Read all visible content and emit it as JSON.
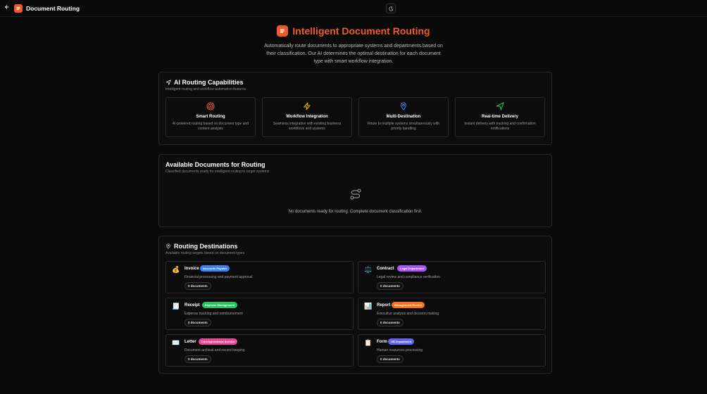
{
  "topbar": {
    "back_icon": "arrow-left-icon",
    "title": "Document Routing",
    "theme_icon": "moon-icon"
  },
  "hero": {
    "title": "Intelligent Document Routing",
    "description": "Automatically route documents to appropriate systems and departments based on their classification. Our AI determines the optimal destination for each document type with smart workflow integration."
  },
  "capabilities": {
    "title": "AI Routing Capabilities",
    "subtitle": "Intelligent routing and workflow automation features",
    "items": [
      {
        "icon": "target-icon",
        "color": "#f05a28",
        "title": "Smart Routing",
        "description": "AI-powered routing based on document type and content analysis"
      },
      {
        "icon": "zap-icon",
        "color": "#eab308",
        "title": "Workflow Integration",
        "description": "Seamless integration with existing business workflows and systems"
      },
      {
        "icon": "map-pin-icon",
        "color": "#3b82f6",
        "title": "Multi-Destination",
        "description": "Route to multiple systems simultaneously with priority handling"
      },
      {
        "icon": "send-icon",
        "color": "#22c55e",
        "title": "Real-time Delivery",
        "description": "Instant delivery with tracking and confirmation notifications"
      }
    ]
  },
  "available": {
    "title": "Available Documents for Routing",
    "subtitle": "Classified documents ready for intelligent routing to target systems",
    "empty_text": "No documents ready for routing. Complete document classification first."
  },
  "destinations": {
    "title": "Routing Destinations",
    "subtitle": "Available routing targets based on document types",
    "items": [
      {
        "emoji": "💰",
        "name": "Invoice",
        "badge": "Accounts Payable",
        "badge_color": "#3b82f6",
        "description": "Financial processing and payment approval",
        "count": "0 documents"
      },
      {
        "emoji": "⚖️",
        "name": "Contract",
        "badge": "Legal Department",
        "badge_color": "#a855f7",
        "description": "Legal review and compliance verification",
        "count": "0 documents"
      },
      {
        "emoji": "🧾",
        "name": "Receipt",
        "badge": "Expense Management",
        "badge_color": "#22c55e",
        "description": "Expense tracking and reimbursement",
        "count": "0 documents"
      },
      {
        "emoji": "📊",
        "name": "Report",
        "badge": "Management Review",
        "badge_color": "#f97316",
        "description": "Executive analysis and decision making",
        "count": "0 documents"
      },
      {
        "emoji": "✉️",
        "name": "Letter",
        "badge": "Correspondence Archive",
        "badge_color": "#ec4899",
        "description": "Document archival and record keeping",
        "count": "0 documents"
      },
      {
        "emoji": "📋",
        "name": "Form",
        "badge": "HR Department",
        "badge_color": "#6366f1",
        "description": "Human resources processing",
        "count": "0 documents"
      }
    ]
  }
}
